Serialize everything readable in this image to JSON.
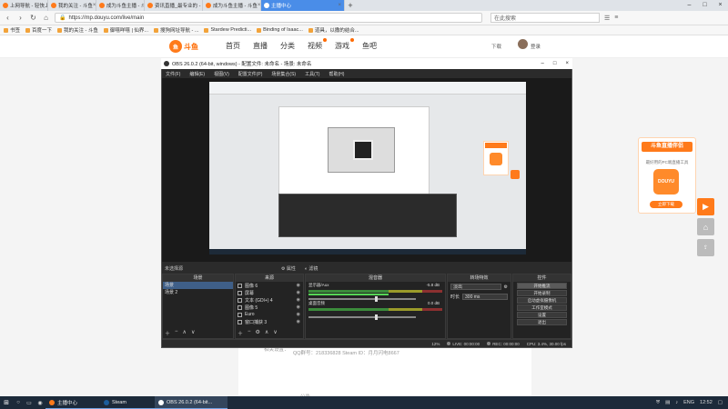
{
  "browser": {
    "tabs": [
      {
        "label": "上网导航 - 轻快上网 从这里开始",
        "active": false
      },
      {
        "label": "我的关注 - 斗鱼",
        "active": false
      },
      {
        "label": "成为斗鱼主播 - 斗鱼",
        "active": false
      },
      {
        "label": "资讯直播_最专业的 - 扩野之..",
        "active": false
      },
      {
        "label": "成为斗鱼主播 - 斗鱼",
        "active": false
      },
      {
        "label": "主播中心",
        "active": true
      }
    ],
    "url": "https://mp.douyu.com/live/main",
    "search_placeholder": "在此搜索",
    "bookmarks": [
      "书签",
      "百度一下",
      "我的关注 - 斗鱼",
      "御嘻咩嘻 | 仙界...",
      "搜狗网址导航 - ...",
      "Stardew Predicti...",
      "Binding of Isaac...",
      "道具，以撒的结合..."
    ]
  },
  "site": {
    "logo_text": "斗鱼",
    "nav": [
      "首页",
      "直播",
      "分类",
      "视频",
      "游戏",
      "鱼吧"
    ],
    "download": "下载",
    "username": "登录",
    "qq_line": "QQ群号：218336828  Steam ID：月月闪电8667",
    "left_label": "相关设置：",
    "bottom_label": "公告",
    "promo": {
      "title": "斗鱼直播伴侣",
      "subtitle": "最好用的PC端直播工具",
      "logo": "DOUYU",
      "button": "立即下载"
    }
  },
  "obs": {
    "title": "OBS 26.0.2 (64-bit, windows) - 配置文件: 未命名 - 场景: 未命名",
    "menu": [
      "文件(F)",
      "编辑(E)",
      "视图(V)",
      "配置文件(P)",
      "场景集合(S)",
      "工具(T)",
      "帮助(H)"
    ],
    "no_source": "未选择源",
    "props": "属性",
    "filters": "滤镜",
    "docks": {
      "scenes": "场景",
      "sources": "来源",
      "mixer": "混音器",
      "transitions": "转场特效",
      "controls": "控件"
    },
    "scenes": [
      {
        "label": "场景",
        "selected": true
      },
      {
        "label": "场景 2",
        "selected": false
      }
    ],
    "sources": [
      "图像 6",
      "屏幕",
      "文本 (GDI+) 4",
      "图像 5",
      "Euro",
      "窗口捕获 3"
    ],
    "mixer": [
      {
        "name": "显示器/Aux",
        "db": "-5.8 dB"
      },
      {
        "name": "桌面音频",
        "db": "0.0 dB"
      }
    ],
    "transition": {
      "type": "淡出",
      "duration_label": "时长",
      "duration": "300 ms"
    },
    "controls": [
      "开始推流",
      "开始录制",
      "启动虚拟摄像机",
      "工作室模式",
      "设置",
      "退出"
    ],
    "status": {
      "live": "LIVE: 00:00:00",
      "rec": "REC: 00:00:00",
      "cpu": "CPU: 3.4%, 30.00 fps",
      "frame": "12%"
    }
  },
  "taskbar": {
    "tasks": [
      {
        "label": "主播中心",
        "active": false
      },
      {
        "label": "Steam",
        "active": false
      },
      {
        "label": "OBS 26.0.2 (64-bit...",
        "active": true
      }
    ],
    "tray": {
      "lang": "ENG",
      "time": "12:52"
    }
  }
}
